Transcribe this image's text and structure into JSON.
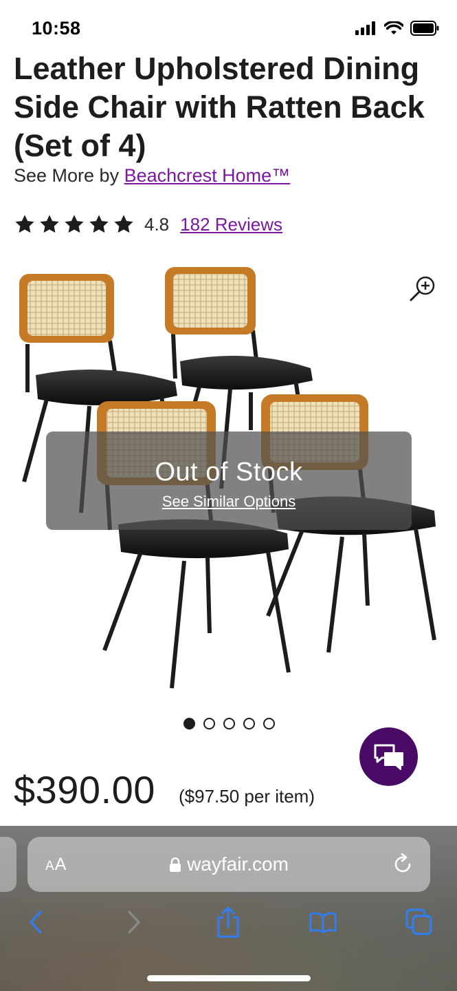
{
  "status": {
    "time": "10:58"
  },
  "product": {
    "title": "Leather Upholstered Dining Side Chair with Ratten Back (Set of 4)",
    "byline_prefix": "See More by ",
    "brand": "Beachcrest Home™",
    "rating": "4.8",
    "stars_count": 5,
    "reviews": "182 Reviews",
    "price": "$390.00",
    "per_item": "($97.50 per item)"
  },
  "image": {
    "overlay_title": "Out of Stock",
    "overlay_link": "See Similar Options",
    "carousel_total": 5,
    "carousel_active": 1
  },
  "browser": {
    "aa_label": "AA",
    "url": "wayfair.com"
  },
  "colors": {
    "brand_purple": "#7b189f",
    "chat_button": "#4a0b67",
    "browser_blue": "#2f7ef5"
  },
  "icons": [
    "zoom-in-icon",
    "chat-icon",
    "lock-icon",
    "reload-icon",
    "back-icon",
    "forward-icon",
    "share-icon",
    "bookmarks-icon",
    "tabs-icon"
  ]
}
